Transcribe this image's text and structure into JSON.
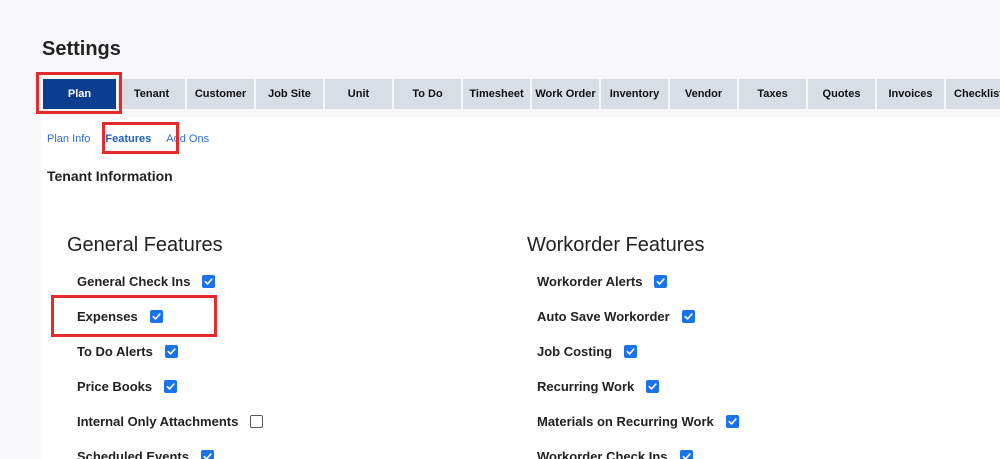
{
  "page_title": "Settings",
  "tabs": [
    {
      "label": "Plan",
      "active": true
    },
    {
      "label": "Tenant"
    },
    {
      "label": "Customer"
    },
    {
      "label": "Job Site"
    },
    {
      "label": "Unit"
    },
    {
      "label": "To Do"
    },
    {
      "label": "Timesheet"
    },
    {
      "label": "Work Order"
    },
    {
      "label": "Inventory"
    },
    {
      "label": "Vendor"
    },
    {
      "label": "Taxes"
    },
    {
      "label": "Quotes"
    },
    {
      "label": "Invoices"
    },
    {
      "label": "Checklists"
    }
  ],
  "subtabs": [
    {
      "label": "Plan Info"
    },
    {
      "label": "Features",
      "active": true
    },
    {
      "label": "Add Ons"
    }
  ],
  "section_label": "Tenant Information",
  "general": {
    "heading": "General Features",
    "items": [
      {
        "label": "General Check Ins",
        "checked": true
      },
      {
        "label": "Expenses",
        "checked": true
      },
      {
        "label": "To Do Alerts",
        "checked": true
      },
      {
        "label": "Price Books",
        "checked": true
      },
      {
        "label": "Internal Only Attachments",
        "checked": false
      },
      {
        "label": "Scheduled Events",
        "checked": true
      }
    ]
  },
  "workorder": {
    "heading": "Workorder Features",
    "items": [
      {
        "label": "Workorder Alerts",
        "checked": true
      },
      {
        "label": "Auto Save Workorder",
        "checked": true
      },
      {
        "label": "Job Costing",
        "checked": true
      },
      {
        "label": "Recurring Work",
        "checked": true
      },
      {
        "label": "Materials on Recurring Work",
        "checked": true
      },
      {
        "label": "Workorder Check Ins",
        "checked": true
      }
    ]
  },
  "colors": {
    "accent": "#0b3d91",
    "link": "#2f6fcf",
    "checkbox": "#1a73e8",
    "highlight": "#e32b2b"
  }
}
